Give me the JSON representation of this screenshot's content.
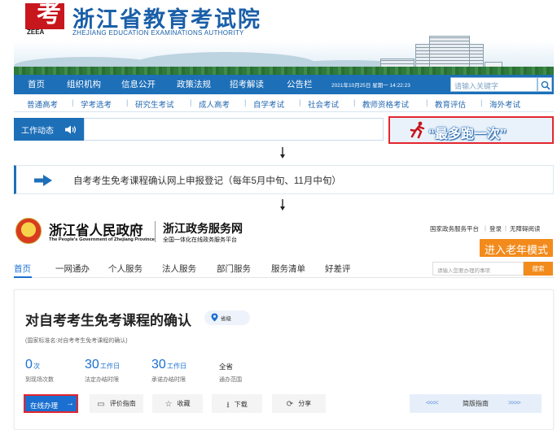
{
  "zjzs": {
    "logo_abbr": "ZEEA",
    "logo_char": "考",
    "title": "浙江省教育考试院",
    "subtitle": "ZHEJIANG EDUCATION EXAMINATIONS AUTHORITY",
    "nav": [
      "首页",
      "组织机构",
      "信息公开",
      "政策法规",
      "招考解读",
      "公告栏"
    ],
    "date": "2021年10月25日 星期一 14:22:23",
    "search_placeholder": "请输入关键字",
    "subnav": [
      "普通高考",
      "学考选考",
      "研究生考试",
      "成人高考",
      "自学考试",
      "社会考试",
      "教师资格考试",
      "教育评估",
      "海外考试"
    ],
    "news_label": "工作动态",
    "slogan": "“最多跑一次”"
  },
  "notice": {
    "text": "自考考生免考课程确认网上申报登记（每年5月中旬、11月中旬）"
  },
  "gov": {
    "name": "浙江省人民政府",
    "name_en": "The People's Government of Zhejiang Province",
    "service_name": "浙江政务服务网",
    "service_sub": "全国一体化在线政务服务平台",
    "top_links": [
      "国家政务服务平台",
      "登录",
      "无障碍阅读"
    ],
    "elder_mode": "进入老年模式",
    "nav": [
      "首页",
      "一网通办",
      "个人服务",
      "法人服务",
      "部门服务",
      "服务清单",
      "好差评"
    ],
    "search_placeholder": "请输入您要办理的事项",
    "search_button": "搜索"
  },
  "service": {
    "title": "对自考考生免考课程的确认",
    "level": "省级",
    "standard_name": "(国家标准名:对自考考生免考课程的确认)",
    "stats": [
      {
        "num": "0",
        "unit": "次",
        "label": "到现场次数"
      },
      {
        "num": "30",
        "unit": "工作日",
        "label": "法定办结时限"
      },
      {
        "num": "30",
        "unit": "工作日",
        "label": "承诺办结时限"
      },
      {
        "value": "全省",
        "label": "通办范围"
      }
    ],
    "online_button": "在线办理",
    "actions": [
      "评价指南",
      "收藏",
      "下载",
      "分享"
    ],
    "simple_guide": "简版指南"
  },
  "colors": {
    "zjzs_blue": "#1d6fb8",
    "gov_blue": "#1a6fd0",
    "orange": "#f28b1c",
    "highlight_red": "#e3262e"
  }
}
